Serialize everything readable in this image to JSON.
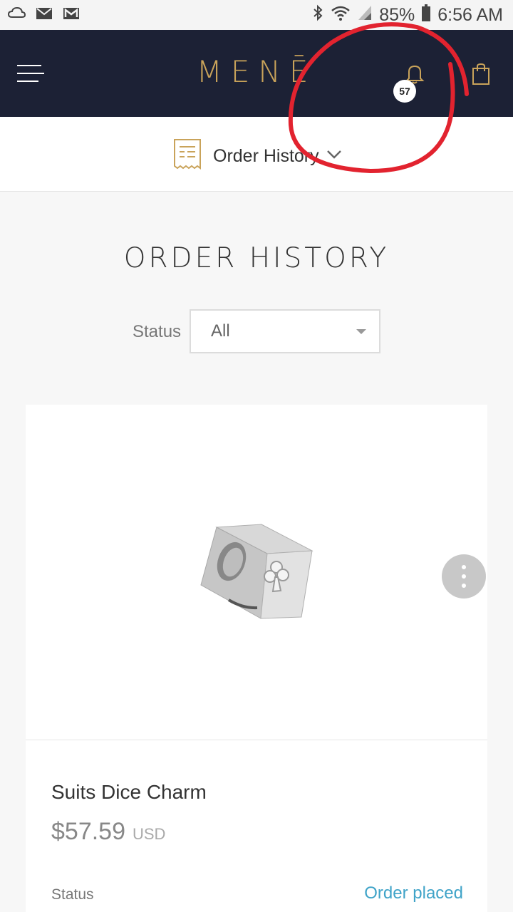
{
  "status_bar": {
    "battery": "85%",
    "time": "6:56 AM",
    "icons": [
      "cloud-sync-icon",
      "mail-icon",
      "gmail-icon",
      "bluetooth-icon",
      "wifi-icon",
      "signal-icon",
      "battery-icon"
    ]
  },
  "header": {
    "logo": "MENĒ",
    "notification_count": "57",
    "icons": [
      "menu-icon",
      "bell-icon",
      "shopping-bag-icon"
    ],
    "accent_color": "#c9a35a",
    "background_color": "#1c2135"
  },
  "subnav": {
    "label": "Order History",
    "icons": [
      "receipt-icon",
      "chevron-down-icon"
    ]
  },
  "page": {
    "title": "ORDER HISTORY",
    "filter_label": "Status",
    "filter_value": "All"
  },
  "orders": [
    {
      "name": "Suits Dice Charm",
      "price": "$57.59",
      "currency": "USD",
      "status_label": "Status",
      "status_value": "Order placed",
      "status_color": "#3fa3c8"
    }
  ]
}
